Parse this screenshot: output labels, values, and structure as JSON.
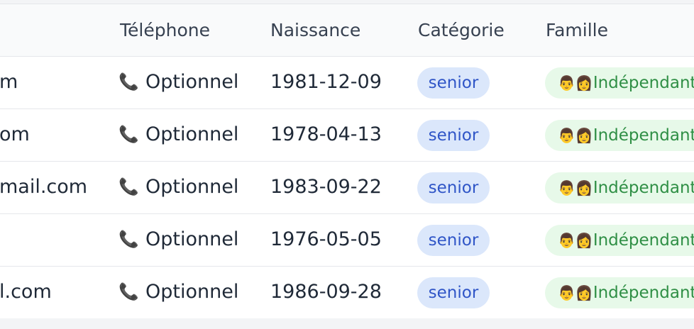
{
  "headers": {
    "telephone": "Téléphone",
    "naissance": "Naissance",
    "categorie": "Catégorie",
    "famille": "Famille"
  },
  "rows": [
    {
      "email": "m",
      "phone_icon": "📞",
      "phone": "Optionnel",
      "birth": "1981-12-09",
      "category": "senior",
      "family_icon": "👨‍👩",
      "family": "Indépendant"
    },
    {
      "email": "om",
      "phone_icon": "📞",
      "phone": "Optionnel",
      "birth": "1978-04-13",
      "category": "senior",
      "family_icon": "👨‍👩",
      "family": "Indépendant"
    },
    {
      "email": "mail.com",
      "phone_icon": "📞",
      "phone": "Optionnel",
      "birth": "1983-09-22",
      "category": "senior",
      "family_icon": "👨‍👩",
      "family": "Indépendant"
    },
    {
      "email": "",
      "phone_icon": "📞",
      "phone": "Optionnel",
      "birth": "1976-05-05",
      "category": "senior",
      "family_icon": "👨‍👩",
      "family": "Indépendant"
    },
    {
      "email": "l.com",
      "phone_icon": "📞",
      "phone": "Optionnel",
      "birth": "1986-09-28",
      "category": "senior",
      "family_icon": "👨‍👩",
      "family": "Indépendant"
    }
  ],
  "colors": {
    "category_badge_bg": "#dbe7fb",
    "category_badge_text": "#2f55c7",
    "family_badge_bg": "#e7f9e9",
    "family_badge_text": "#2f8f45"
  }
}
